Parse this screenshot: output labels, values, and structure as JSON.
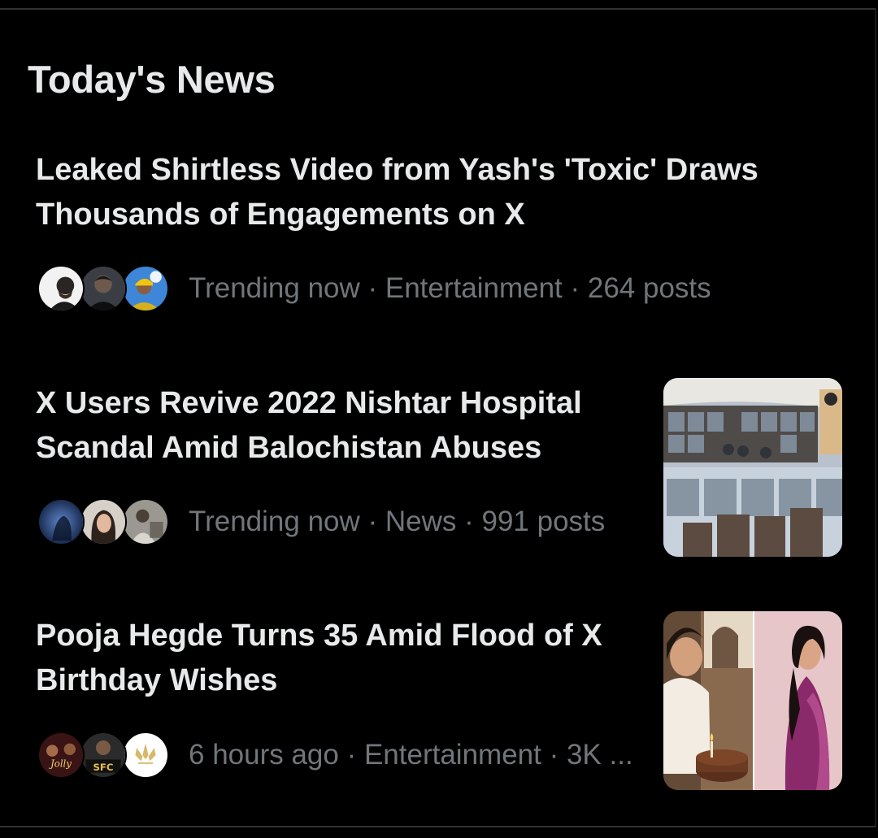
{
  "section": {
    "title": "Today's News"
  },
  "items": [
    {
      "headline_line1": "Leaked Shirtless Video from Yash's 'Toxic' Draws",
      "headline_line2": "Thousands of Engagements on X",
      "meta": "Trending now · Entertainment · 264 posts",
      "has_thumbnail": false
    },
    {
      "headline_line1": "X Users Revive 2022 Nishtar Hospital",
      "headline_line2": "Scandal Amid Balochistan Abuses",
      "meta": "Trending now · News · 991 posts",
      "has_thumbnail": true
    },
    {
      "headline_line1": "Pooja Hegde Turns 35 Amid Flood of X",
      "headline_line2": "Birthday Wishes",
      "meta": "6 hours ago · Entertainment · 3K ...",
      "has_thumbnail": true
    }
  ],
  "avatar_texts": {
    "jolly": "Jolly",
    "sfc": "SFC"
  },
  "colors": {
    "background": "#000000",
    "text_primary": "#e7e9ea",
    "text_secondary": "#71767b",
    "divider": "#2f3336"
  }
}
